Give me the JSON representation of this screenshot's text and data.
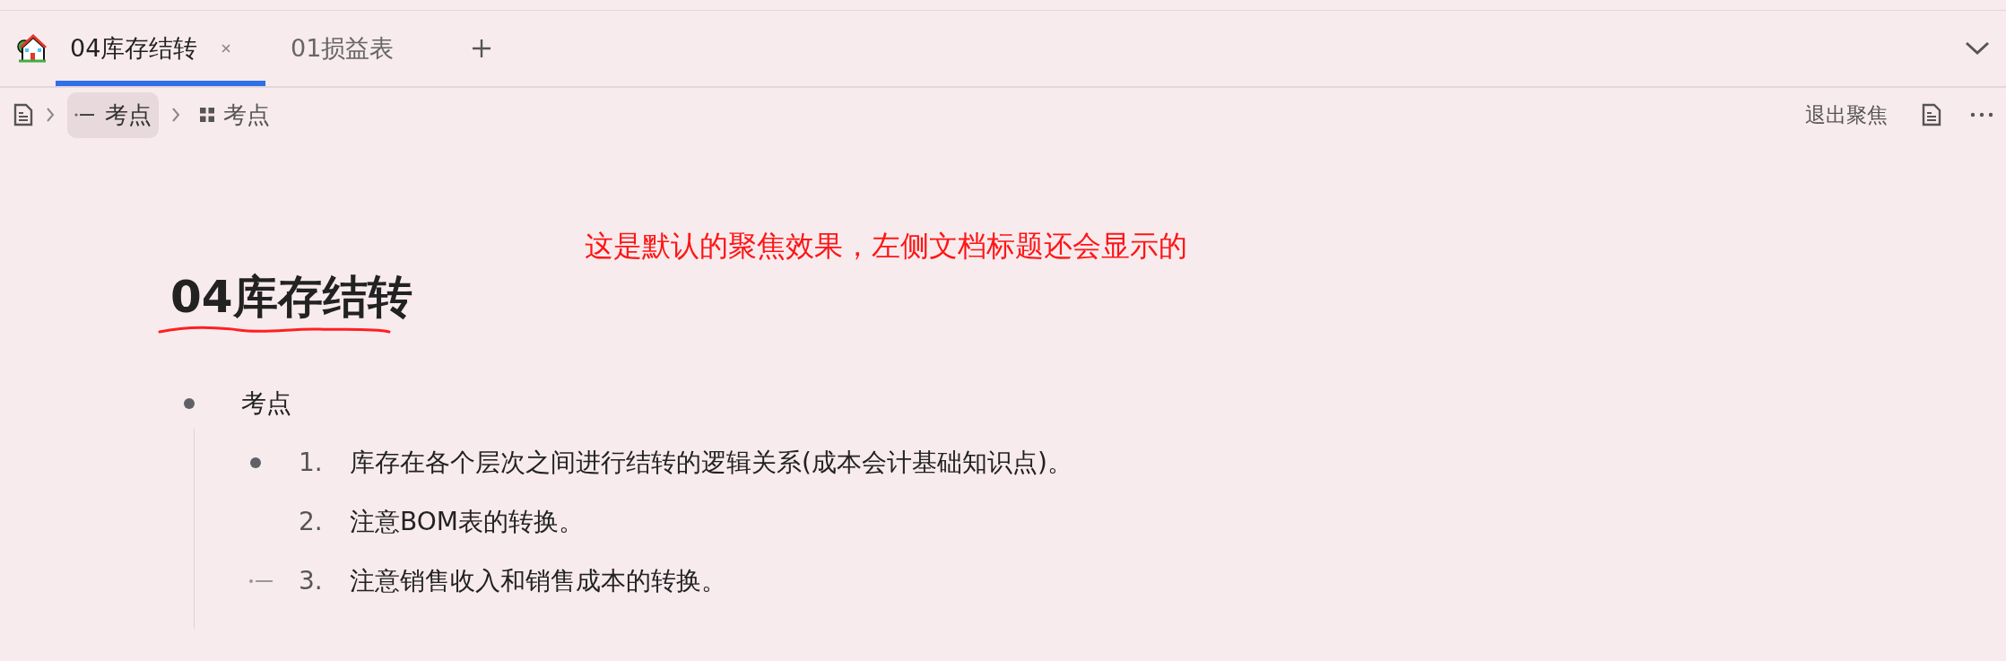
{
  "tabs": [
    {
      "label": "04库存结转",
      "selected": true
    },
    {
      "label": "01损益表",
      "selected": false
    }
  ],
  "breadcrumb": [
    {
      "kind": "heading",
      "label": "考点",
      "selected": true
    },
    {
      "kind": "list",
      "label": "考点",
      "selected": false
    }
  ],
  "toolbar": {
    "exit_focus": "退出聚焦"
  },
  "annotation": "这是默认的聚焦效果，左侧文档标题还会显示的",
  "document": {
    "title": "04库存结转",
    "items": [
      {
        "text": "考点",
        "kind": "dot",
        "children": [
          {
            "number": "1.",
            "text": "库存在各个层次之间进行结转的逻辑关系(成本会计基础知识点)。",
            "kind": "dot"
          },
          {
            "number": "2.",
            "text": "注意BOM表的转换。",
            "kind": "plain"
          },
          {
            "number": "3.",
            "text": "注意销售收入和销售成本的转换。",
            "kind": "dash"
          }
        ]
      }
    ]
  }
}
